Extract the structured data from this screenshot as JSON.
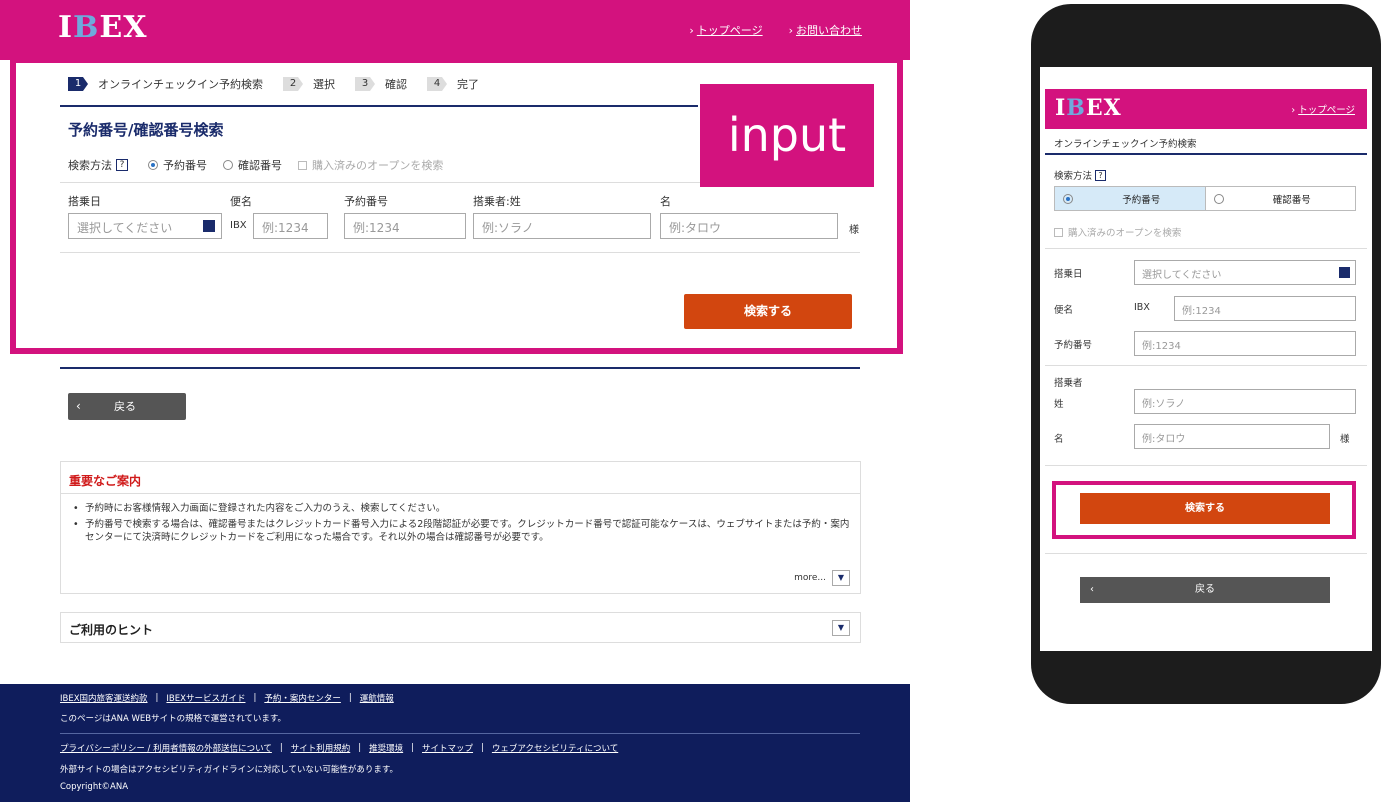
{
  "desktop": {
    "logo": {
      "first": "I",
      "accent": "B",
      "rest": "EX"
    },
    "top_links": [
      "トップページ",
      "お問い合わせ"
    ],
    "steps": [
      {
        "num": "1",
        "label": "オンラインチェックイン予約検索"
      },
      {
        "num": "2",
        "label": "選択"
      },
      {
        "num": "3",
        "label": "確認"
      },
      {
        "num": "4",
        "label": "完了"
      }
    ],
    "title": "予約番号/確認番号検索",
    "search_method": {
      "label": "検索方法",
      "help": "?",
      "options": [
        "予約番号",
        "確認番号"
      ],
      "selected": "予約番号",
      "checkbox_label": "購入済みのオープンを検索"
    },
    "fields": {
      "date_label": "搭乗日",
      "date_placeholder": "選択してください",
      "flight_label": "便名",
      "flight_prefix": "IBX",
      "flight_placeholder": "例:1234",
      "booking_label": "予約番号",
      "booking_placeholder": "例:1234",
      "lastname_label": "搭乗者:姓",
      "lastname_placeholder": "例:ソラノ",
      "firstname_label": "名",
      "firstname_placeholder": "例:タロウ",
      "honorific": "様"
    },
    "search_button": "検索する",
    "badge": "input",
    "back_button": "戻る",
    "notice": {
      "title": "重要なご案内",
      "items": [
        "予約時にお客様情報入力画面に登録された内容をご入力のうえ、検索してください。",
        "予約番号で検索する場合は、確認番号またはクレジットカード番号入力による2段階認証が必要です。クレジットカード番号で認証可能なケースは、ウェブサイトまたは予約・案内センターにて決済時にクレジットカードをご利用になった場合です。それ以外の場合は確認番号が必要です。"
      ],
      "more": "more..."
    },
    "hint_title": "ご利用のヒント",
    "footer": {
      "links1": [
        "IBEX国内旅客運送約款",
        "IBEXサービスガイド",
        "予約・案内センター",
        "運航情報"
      ],
      "note1": "このページはANA WEBサイトの規格で運営されています。",
      "links2": [
        "プライバシーポリシー / 利用者情報の外部送信について",
        "サイト利用規約",
        "推奨環境",
        "サイトマップ",
        "ウェブアクセシビリティについて"
      ],
      "note2": "外部サイトの場合はアクセシビリティガイドラインに対応していない可能性があります。",
      "copyright": "Copyright©ANA"
    }
  },
  "phone": {
    "top_link": "トップページ",
    "title": "オンラインチェックイン予約検索",
    "search_method_label": "検索方法",
    "options": [
      "予約番号",
      "確認番号"
    ],
    "checkbox_label": "購入済みのオープンを検索",
    "date_label": "搭乗日",
    "date_placeholder": "選択してください",
    "flight_label": "便名",
    "flight_prefix": "IBX",
    "flight_placeholder": "例:1234",
    "booking_label": "予約番号",
    "booking_placeholder": "例:1234",
    "passenger_label": "搭乗者",
    "lastname_label": "姓",
    "lastname_placeholder": "例:ソラノ",
    "firstname_label": "名",
    "firstname_placeholder": "例:タロウ",
    "honorific": "様",
    "search_button": "検索する",
    "back_button": "戻る"
  },
  "colors": {
    "brand_pink": "#d3127e",
    "navy": "#1a2b6b",
    "orange": "#d2460f",
    "footer_navy": "#0f1d5c"
  }
}
